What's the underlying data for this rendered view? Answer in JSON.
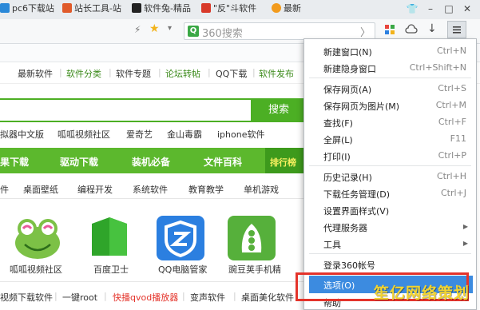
{
  "window": {
    "controls": [
      "shirt-icon",
      "minimize",
      "maximize",
      "close"
    ]
  },
  "toolbar": {
    "search_placeholder": "360搜索",
    "search_prefix": "Q"
  },
  "bookmarks": [
    {
      "label": "pc6下载站",
      "color": "#2a88d8"
    },
    {
      "label": "站长工具-站",
      "color": "#e05b2b"
    },
    {
      "label": "软件兔-精品",
      "color": "#222222"
    },
    {
      "label": "\"反\"斗软件",
      "color": "#d83a2a"
    },
    {
      "label": "最新",
      "color": "#f29b1d"
    }
  ],
  "site_nav": [
    "最新软件",
    "软件分类",
    "软件专题",
    "论坛转帖",
    "QQ下载",
    "软件发布"
  ],
  "site_search": {
    "button": "搜索"
  },
  "hot_words": [
    "拟器中文版",
    "呱呱视频社区",
    "爱奇艺",
    "金山毒霸",
    "iphone软件"
  ],
  "categories": [
    "果下载",
    "驱动下载",
    "装机必备",
    "文件百科",
    "排行榜"
  ],
  "sub_categories": [
    "件",
    "桌面壁纸",
    "编程开发",
    "系统软件",
    "教育教学",
    "单机游戏"
  ],
  "apps": [
    {
      "label": "呱呱视频社区",
      "icon": "frog-icon",
      "color": "#7cc146"
    },
    {
      "label": "百度卫士",
      "icon": "shield-icon",
      "color": "#2fa52a"
    },
    {
      "label": "QQ电脑管家",
      "icon": "qq-shield-icon",
      "color": "#2b7fe0"
    },
    {
      "label": "豌豆荚手机精",
      "icon": "peapod-icon",
      "color": "#56b03b"
    }
  ],
  "bottom_links": [
    "视频下载软件",
    "一键root",
    "快播qvod播放器",
    "变声软件",
    "桌面美化软件"
  ],
  "bottom_link_colors": {
    "highlight": "#e4342b"
  },
  "menu": {
    "items": [
      {
        "label": "新建窗口(N)",
        "shortcut": "Ctrl+N"
      },
      {
        "label": "新建隐身窗口",
        "shortcut": "Ctrl+Shift+N"
      },
      {
        "label": "保存网页(A)",
        "shortcut": "Ctrl+S"
      },
      {
        "label": "保存网页为图片(M)",
        "shortcut": "Ctrl+M"
      },
      {
        "label": "查找(F)",
        "shortcut": "Ctrl+F"
      },
      {
        "label": "全屏(L)",
        "shortcut": "F11"
      },
      {
        "label": "打印(I)",
        "shortcut": "Ctrl+P"
      },
      {
        "label": "历史记录(H)",
        "shortcut": "Ctrl+H"
      },
      {
        "label": "下载任务管理(D)",
        "shortcut": "Ctrl+J"
      },
      {
        "label": "设置界面样式(V)",
        "shortcut": ""
      },
      {
        "label": "代理服务器",
        "shortcut": ""
      },
      {
        "label": "工具",
        "shortcut": ""
      },
      {
        "label": "登录360帐号",
        "shortcut": ""
      },
      {
        "label": "选项(O)",
        "shortcut": ""
      },
      {
        "label": "帮助",
        "shortcut": ""
      }
    ],
    "highlight_color": "#3c8be0"
  },
  "watermark": "笙亿网络策划",
  "colors": {
    "green": "#5cb82d",
    "highlight_box": "#e4342b"
  }
}
